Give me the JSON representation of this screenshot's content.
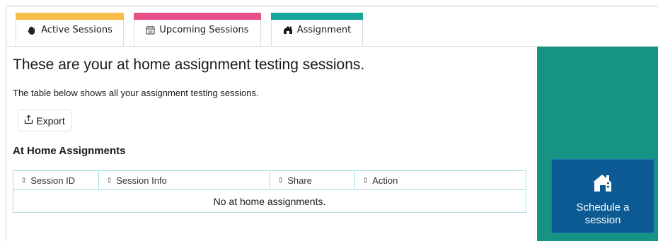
{
  "tabs": [
    {
      "label": "Active Sessions",
      "icon": "hand-icon",
      "color": "#f7be48"
    },
    {
      "label": "Upcoming Sessions",
      "icon": "calendar-icon",
      "color": "#e8508a"
    },
    {
      "label": "Assignment",
      "icon": "home-icon",
      "color": "#16a79a",
      "active": true
    }
  ],
  "main": {
    "title": "These are your at home assignment testing sessions.",
    "subtitle": "The table below shows all your assignment testing sessions.",
    "export_label": "Export",
    "section_title": "At Home Assignments"
  },
  "table": {
    "columns": [
      "Session ID",
      "Session Info",
      "Share",
      "Action"
    ],
    "empty_message": "No at home assignments."
  },
  "sidebar": {
    "schedule_label": "Schedule a session",
    "panel_color": "#159484",
    "button_color": "#0b5a93"
  }
}
